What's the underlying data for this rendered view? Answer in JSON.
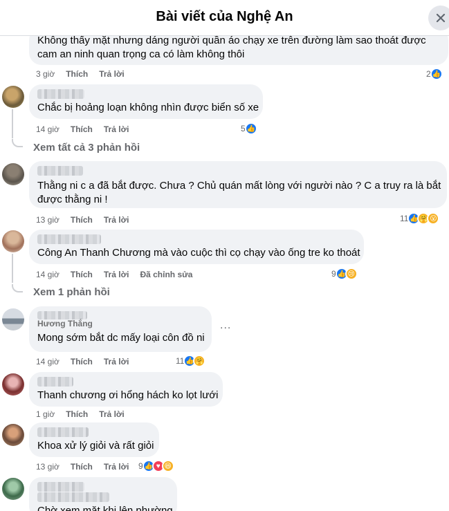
{
  "header": {
    "title": "Bài viết của Nghệ An"
  },
  "comments": [
    {
      "line1": "Không thấy mặt nhưng dáng người quần áo chạy xe trên đường làm sao thoát được",
      "line2": "cam an ninh quan trọng ca có làm không thôi",
      "time": "3 giờ",
      "like": "Thích",
      "reply": "Trả lời",
      "count": "2"
    },
    {
      "name_blur": "Trần Nguyễn",
      "text": "Chắc bị hoảng loạn không nhìn được biển số xe",
      "time": "14 giờ",
      "like": "Thích",
      "reply": "Trả lời",
      "count": "5",
      "view_replies": "Xem tất cả 3 phản hồi"
    },
    {
      "name_blur": "Lê Văn",
      "line1": "Thằng ni c a đã bắt được. Chưa ? Chủ quán mất lòng với người nào ? C a truy ra là bắt",
      "line2": "được thằng ni !",
      "time": "13 giờ",
      "like": "Thích",
      "reply": "Trả lời",
      "count": "11"
    },
    {
      "name_blur": "Nguyễn",
      "text": "Công An Thanh Chương mà vào cuộc thì cọ chạy vào ống tre ko thoát",
      "time": "14 giờ",
      "like": "Thích",
      "reply": "Trả lời",
      "edited": "Đã chỉnh sửa",
      "count": "9",
      "view_replies": "Xem 1 phản hồi"
    },
    {
      "name": "Hương Thắng",
      "text": "Mong sớm bắt dc mấy loại côn đồ ni",
      "time": "14 giờ",
      "like": "Thích",
      "reply": "Trả lời",
      "count": "11",
      "more": "..."
    },
    {
      "name_blur": "Phạm",
      "text": "Thanh chương ơi hổng hách ko lọt lưới",
      "time": "1 giờ",
      "like": "Thích",
      "reply": "Trả lời"
    },
    {
      "name_blur": "Hoàng",
      "text": "Khoa xử lý giỏi và rất giỏi",
      "time": "13 giờ",
      "like": "Thích",
      "reply": "Trả lời",
      "count": "9"
    },
    {
      "name_blur": "Đặng",
      "text": "Chờ xem mặt khi lên phường"
    }
  ],
  "colors": {
    "like": "#1877f2",
    "love": "#f33e58",
    "haha": "#f7b125",
    "bubble": "#f0f2f5",
    "meta": "#65676b"
  }
}
